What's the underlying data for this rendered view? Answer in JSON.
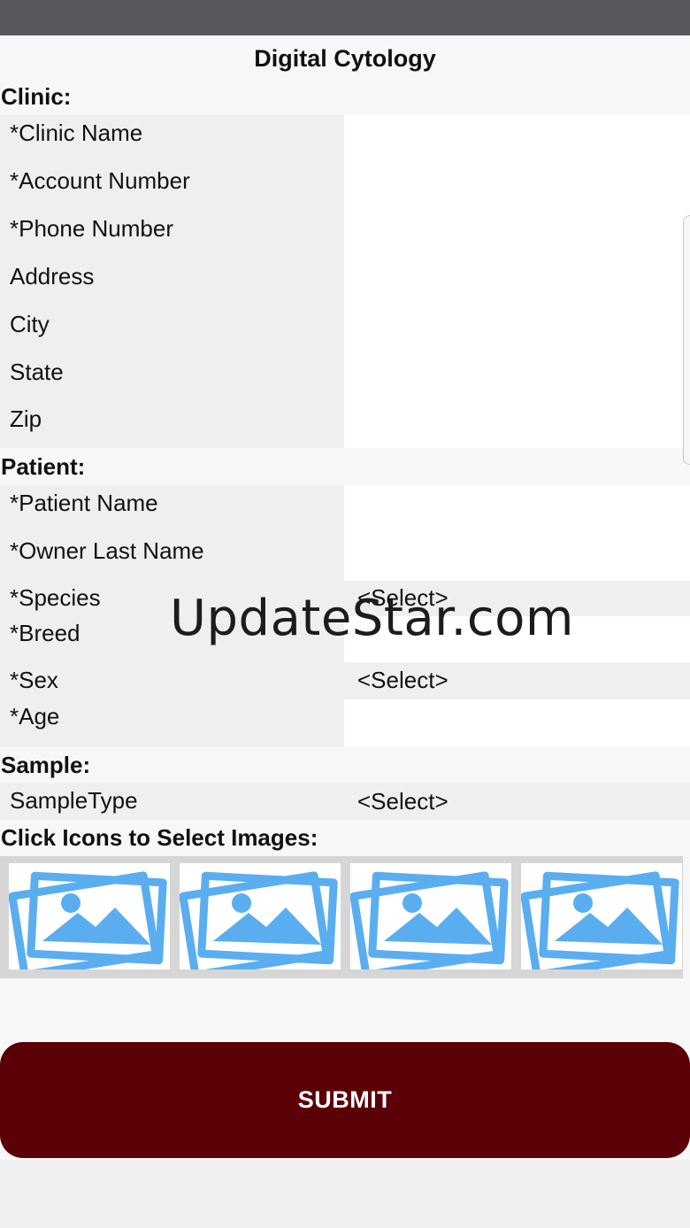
{
  "app": {
    "title": "Digital Cytology"
  },
  "sections": {
    "clinic": "Clinic:",
    "patient": "Patient:",
    "sample": "Sample:",
    "images": "Click Icons to Select Images:"
  },
  "clinic_fields": [
    {
      "label": "*Clinic Name",
      "value": ""
    },
    {
      "label": "*Account Number",
      "value": ""
    },
    {
      "label": "*Phone Number",
      "value": ""
    },
    {
      "label": "Address",
      "value": ""
    },
    {
      "label": "City",
      "value": ""
    },
    {
      "label": "State",
      "value": ""
    },
    {
      "label": "Zip",
      "value": ""
    }
  ],
  "patient_fields": {
    "patient_name": {
      "label": "*Patient Name",
      "value": ""
    },
    "owner_last_name": {
      "label": "*Owner Last Name",
      "value": ""
    },
    "species": {
      "label": "*Species",
      "selected": "<Select>"
    },
    "breed": {
      "label": "*Breed",
      "value": ""
    },
    "sex": {
      "label": "*Sex",
      "selected": "<Select>"
    },
    "age": {
      "label": "*Age",
      "value": ""
    }
  },
  "sample_fields": {
    "sample_type": {
      "label": "SampleType",
      "selected": "<Select>"
    }
  },
  "image_slots": [
    "image-picker-icon",
    "image-picker-icon",
    "image-picker-icon",
    "image-picker-icon"
  ],
  "colors": {
    "icon_blue": "#5aaef0",
    "submit_bg": "#5a0006",
    "status_bar": "#56585c"
  },
  "watermark": "UpdateStar.com",
  "submit_label": "SUBMIT"
}
